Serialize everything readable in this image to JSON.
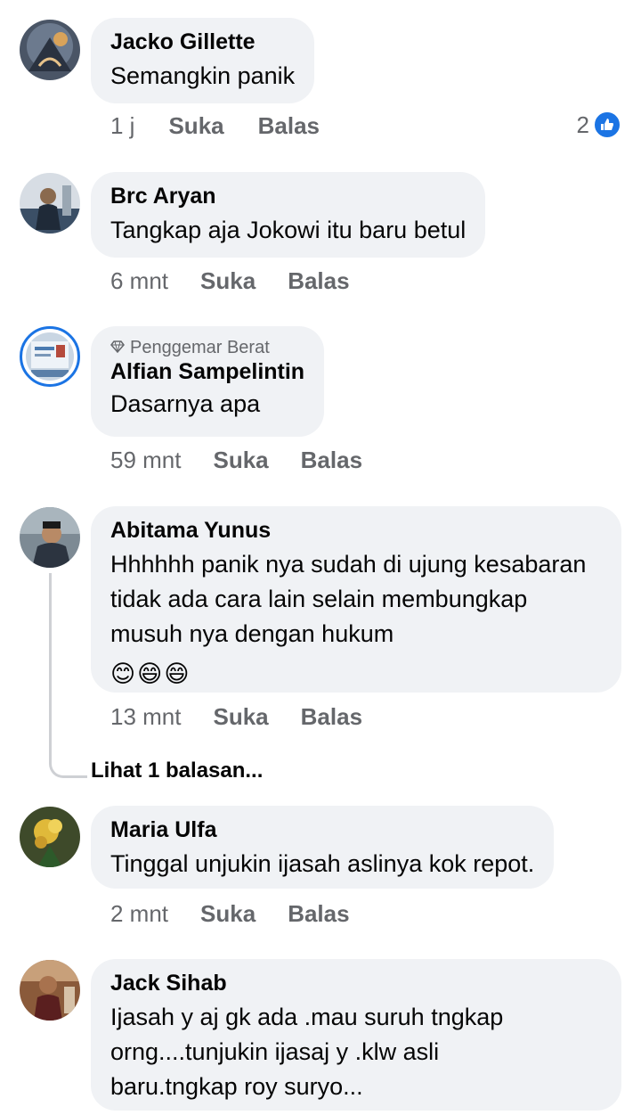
{
  "comments": [
    {
      "author": "Jacko Gillette",
      "text": "Semangkin panik",
      "time": "1 j",
      "like_label": "Suka",
      "reply_label": "Balas",
      "reaction_count": "2"
    },
    {
      "author": "Brc Aryan",
      "text": "Tangkap aja Jokowi itu baru betul",
      "time": "6 mnt",
      "like_label": "Suka",
      "reply_label": "Balas"
    },
    {
      "badge": "Penggemar Berat",
      "author": "Alfian Sampelintin",
      "text": "Dasarnya apa",
      "time": "59 mnt",
      "like_label": "Suka",
      "reply_label": "Balas"
    },
    {
      "author": "Abitama Yunus",
      "text": "Hhhhhh panik nya sudah di ujung kesabaran tidak ada cara lain selain membungkap musuh nya dengan hukum",
      "emojis": [
        "😊",
        "😄",
        "😄"
      ],
      "time": "13 mnt",
      "like_label": "Suka",
      "reply_label": "Balas",
      "view_replies": "Lihat 1 balasan..."
    },
    {
      "author": "Maria Ulfa",
      "text": "Tinggal unjukin ijasah aslinya kok repot.",
      "time": "2 mnt",
      "like_label": "Suka",
      "reply_label": "Balas"
    },
    {
      "author": "Jack Sihab",
      "text_lines": [
        "Ijasah y aj gk ada .mau suruh tngkap",
        "orng....tunjukin ijasaj y .klw asli",
        "baru.tngkap roy suryo..."
      ]
    }
  ],
  "colors": {
    "bubble": "#f0f2f5",
    "secondary_text": "#65676b",
    "accent": "#1b74e4"
  }
}
